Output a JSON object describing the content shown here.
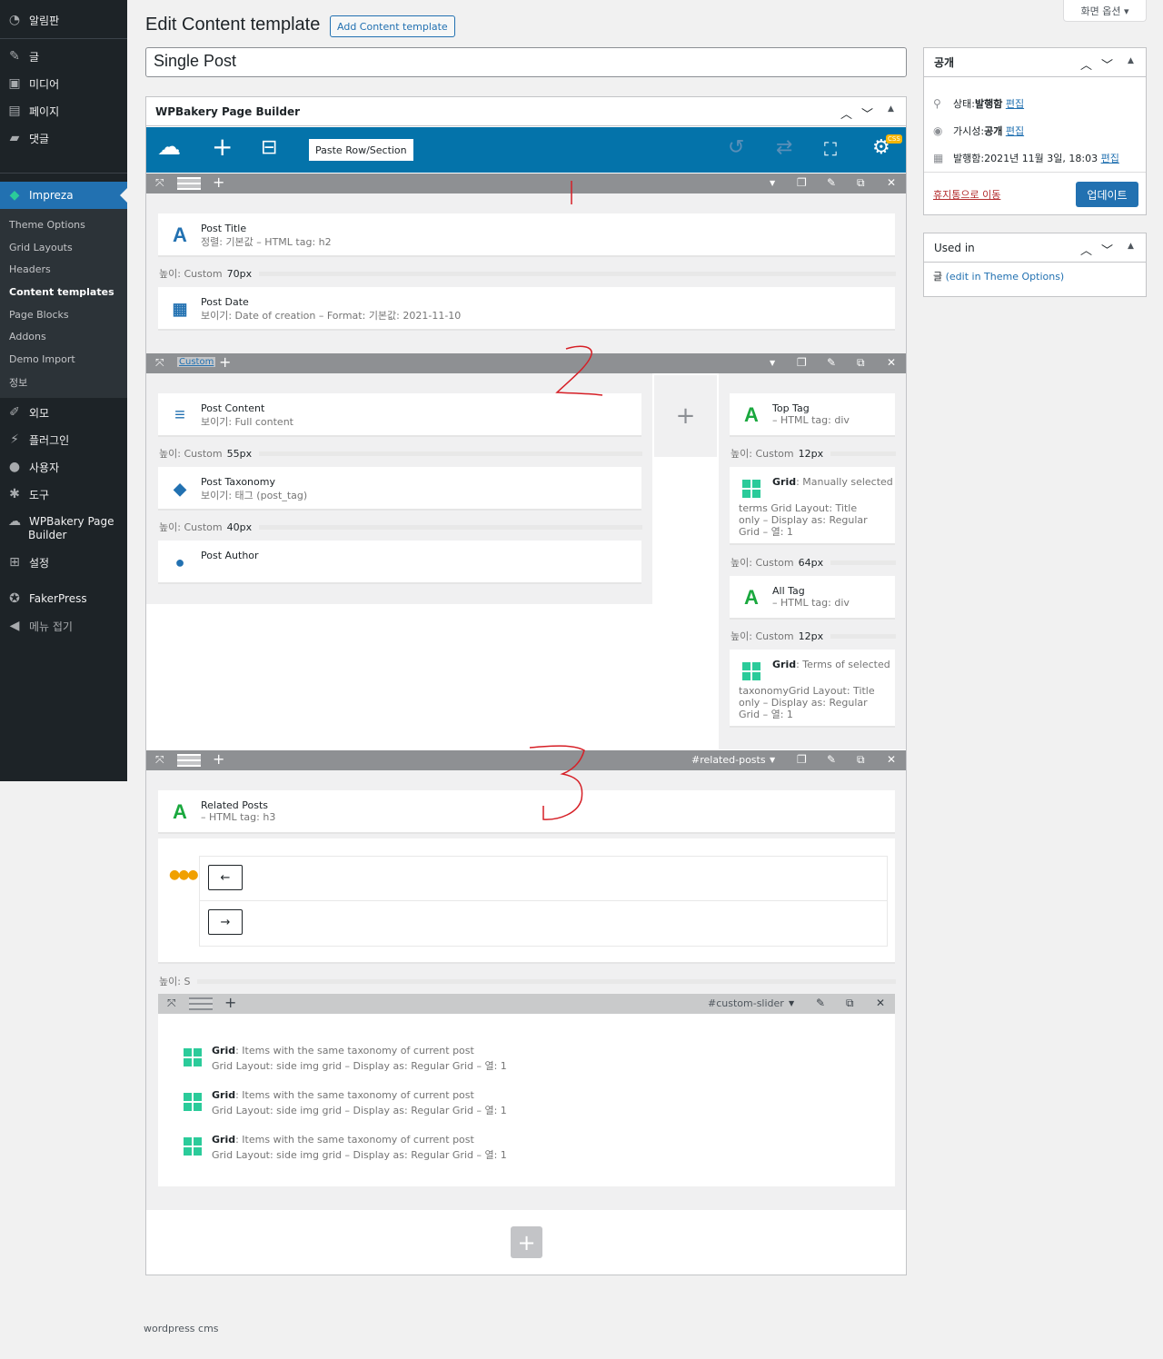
{
  "menu": {
    "dashboard": "알림판",
    "posts": "글",
    "media": "미디어",
    "pages": "페이지",
    "comments": "댓글",
    "impreza": "Impreza",
    "submenu": [
      "Theme Options",
      "Grid Layouts",
      "Headers",
      "Content templates",
      "Page Blocks",
      "Addons",
      "Demo Import",
      "정보"
    ],
    "appearance": "외모",
    "plugins": "플러그인",
    "users": "사용자",
    "tools": "도구",
    "wpbakery1": "WPBakery Page",
    "wpbakery2": "Builder",
    "settings": "설정",
    "fakerpress": "FakerPress",
    "collapse": "메뉴 접기"
  },
  "header": {
    "title": "Edit Content template",
    "add_button": "Add Content template",
    "screen_options": "화면 옵션 ▾",
    "post_title": "Single Post"
  },
  "builder": {
    "box_title": "WPBakery Page Builder",
    "paste": "Paste Row/Section",
    "css_badge": "CSS",
    "row2_label": "Custom",
    "row3_label": "#related-posts",
    "inner_label": "#custom-slider",
    "row1": {
      "post_title": {
        "title": "Post Title",
        "sub": "정렬: 기본값  – HTML tag: h2"
      },
      "sep1": {
        "label": "높이: Custom",
        "value": "70px"
      },
      "post_date": {
        "title": "Post Date",
        "sub": "보이기: Date of creation  – Format: 기본값: 2021-11-10"
      }
    },
    "row2": {
      "post_content": {
        "title": "Post Content",
        "sub": "보이기: Full content"
      },
      "sep1": {
        "label": "높이: Custom",
        "value": "55px"
      },
      "post_taxonomy": {
        "title": "Post Taxonomy",
        "sub": "보이기: 태그 (post_tag)"
      },
      "sep2": {
        "label": "높이: Custom",
        "value": "40px"
      },
      "post_author": {
        "title": "Post Author"
      },
      "top_tag": {
        "title": "Top Tag",
        "sub": "– HTML tag: div"
      },
      "sep3": {
        "label": "높이: Custom",
        "value": "12px"
      },
      "grid1": {
        "title": "Grid",
        "rest": ": Manually selected",
        "l1": "terms   Grid Layout: Title",
        "l2": "only  – Display as: Regular",
        "l3": "Grid  – 열: 1"
      },
      "sep4": {
        "label": "높이: Custom",
        "value": "64px"
      },
      "all_tag": {
        "title": "All Tag",
        "sub": "– HTML tag: div"
      },
      "sep5": {
        "label": "높이: Custom",
        "value": "12px"
      },
      "grid2": {
        "title": "Grid",
        "rest": ": Terms of selected",
        "l1": "taxonomyGrid Layout: Title",
        "l2": "only  – Display as: Regular",
        "l3": "Grid  – 열: 1"
      }
    },
    "row3": {
      "related": {
        "title": "Related Posts",
        "sub": "– HTML tag: h3"
      },
      "prev": "←",
      "next": "→",
      "sep": {
        "label": "높이: S"
      },
      "grids": [
        {
          "title": "Grid",
          "rest": ": Items with the same taxonomy of current post",
          "sub": "Grid Layout: side img grid  – Display as: Regular Grid  – 열: 1"
        },
        {
          "title": "Grid",
          "rest": ": Items with the same taxonomy of current post",
          "sub": "Grid Layout: side img grid  – Display as: Regular Grid  – 열: 1"
        },
        {
          "title": "Grid",
          "rest": ": Items with the same taxonomy of current post",
          "sub": "Grid Layout: side img grid  – Display as: Regular Grid  – 열: 1"
        }
      ]
    }
  },
  "publish": {
    "title": "공개",
    "status_label": "상태: ",
    "status_value": "발행함",
    "visibility_label": "가시성: ",
    "visibility_value": "공개",
    "published_label": "발행함: ",
    "published_value": "2021년 11월 3일, 18:03",
    "edit": "편집",
    "trash": "휴지통으로 이동",
    "update": "업데이트"
  },
  "used_in": {
    "title": "Used in",
    "prefix": "글",
    "link": "(edit in Theme Options)"
  },
  "footer": "wordpress cms",
  "annotations": [
    "1",
    "2",
    "3"
  ],
  "colors": {
    "accent": "#2271b1",
    "toolbar": "#0473aa",
    "admin_bg": "#1d2327",
    "grid_icon": "#2bcb9a"
  }
}
